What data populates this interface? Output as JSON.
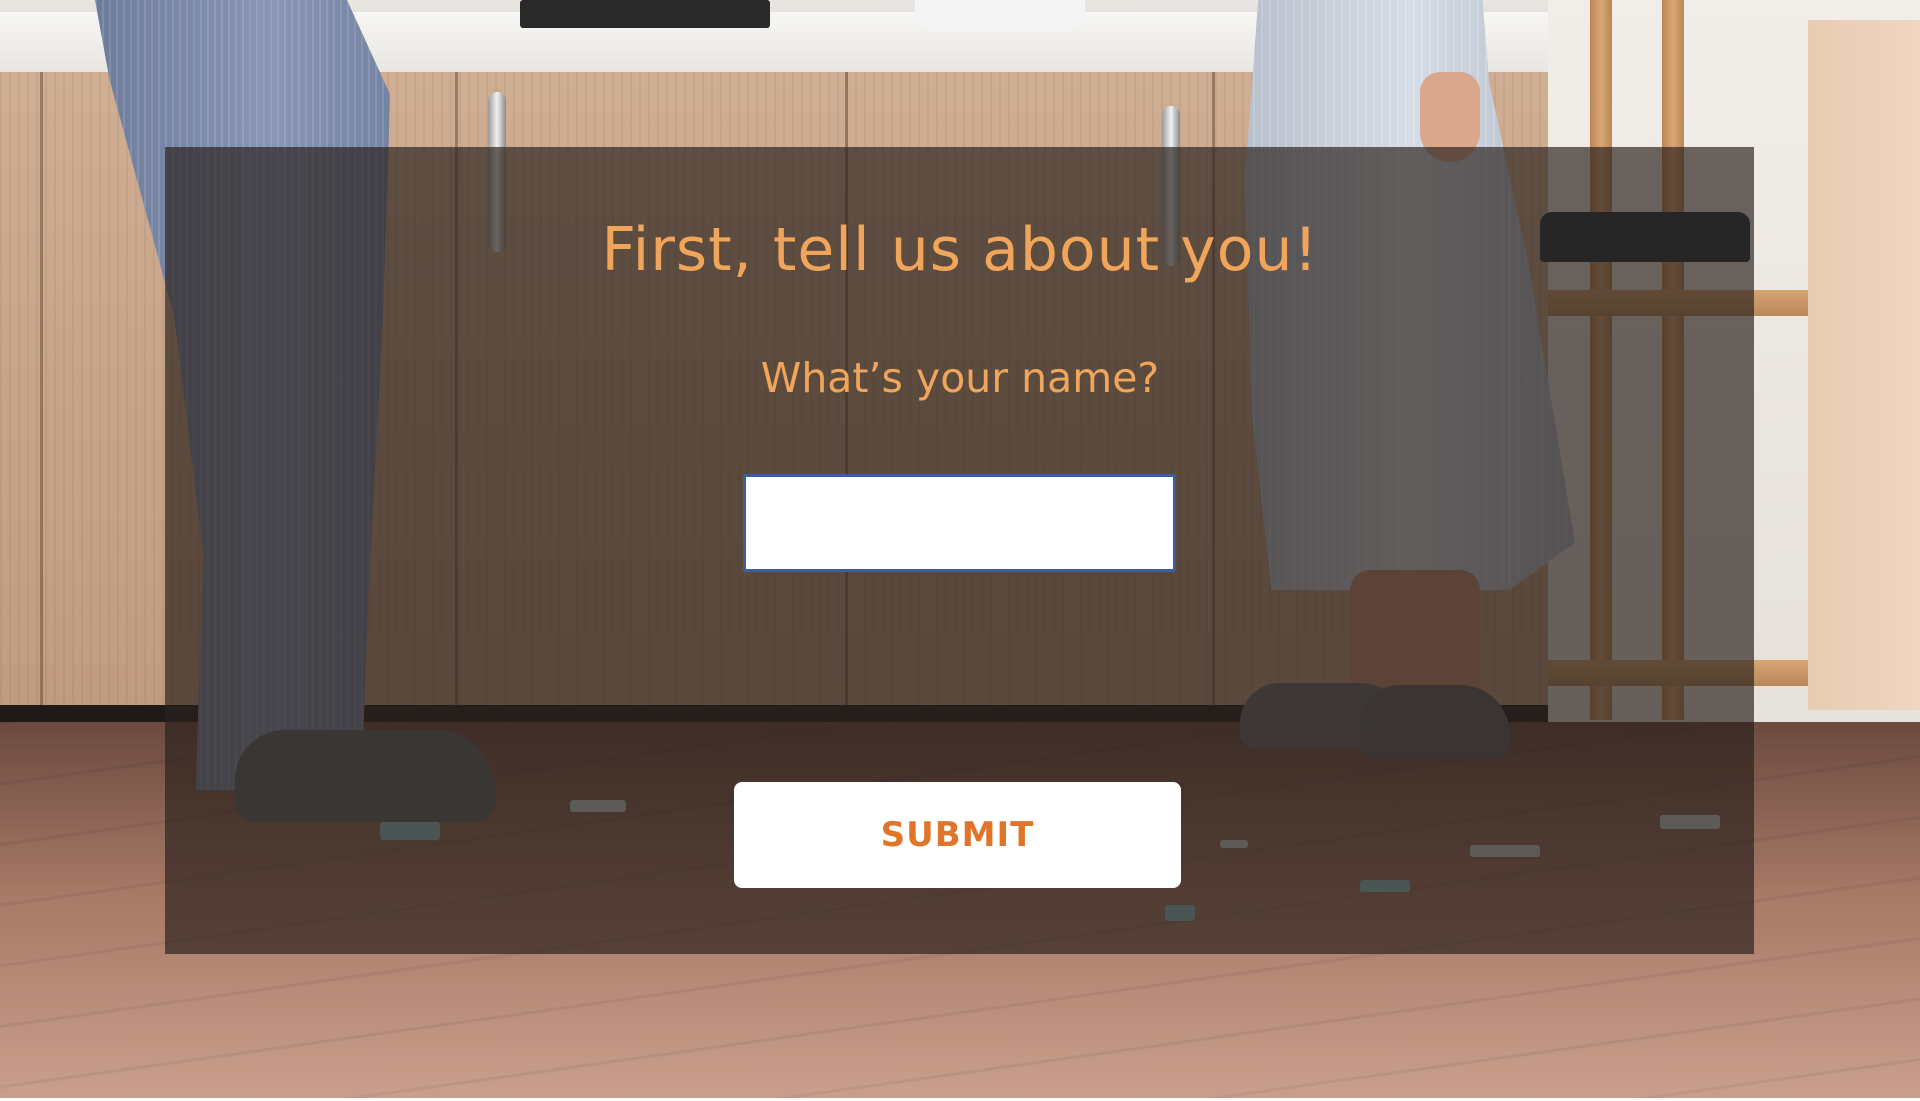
{
  "form": {
    "heading": "First, tell us about you!",
    "question": "What’s your name?",
    "name_input_value": "",
    "name_input_placeholder": "",
    "submit_label": "SUBMIT"
  },
  "theme": {
    "heading_color": "#f0a55a",
    "button_text_color": "#e0752a",
    "input_border_color": "#3a5f9a",
    "overlay_color": "rgba(42, 32, 28, 0.68)"
  },
  "background": {
    "scene": "kitchen-photo"
  }
}
